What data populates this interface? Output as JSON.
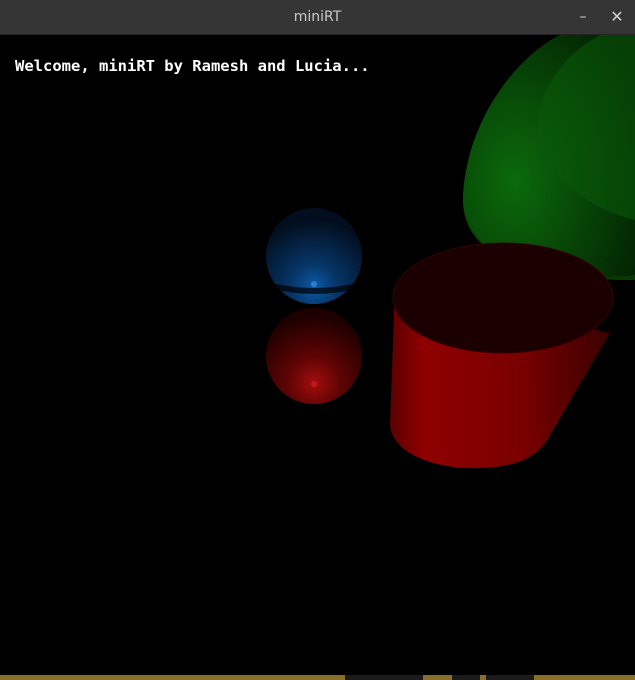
{
  "window": {
    "title": "miniRT",
    "minimize_label": "–",
    "close_label": "✕"
  },
  "scene": {
    "welcome_text": "Welcome, miniRT by Ramesh and Lucia...",
    "objects": [
      {
        "kind": "sphere",
        "color": "#0d5aa6"
      },
      {
        "kind": "sphere",
        "color": "#a30d0d"
      },
      {
        "kind": "cylinder",
        "color": "#a00000"
      },
      {
        "kind": "cylinder",
        "color": "#0a6a0a"
      }
    ]
  }
}
